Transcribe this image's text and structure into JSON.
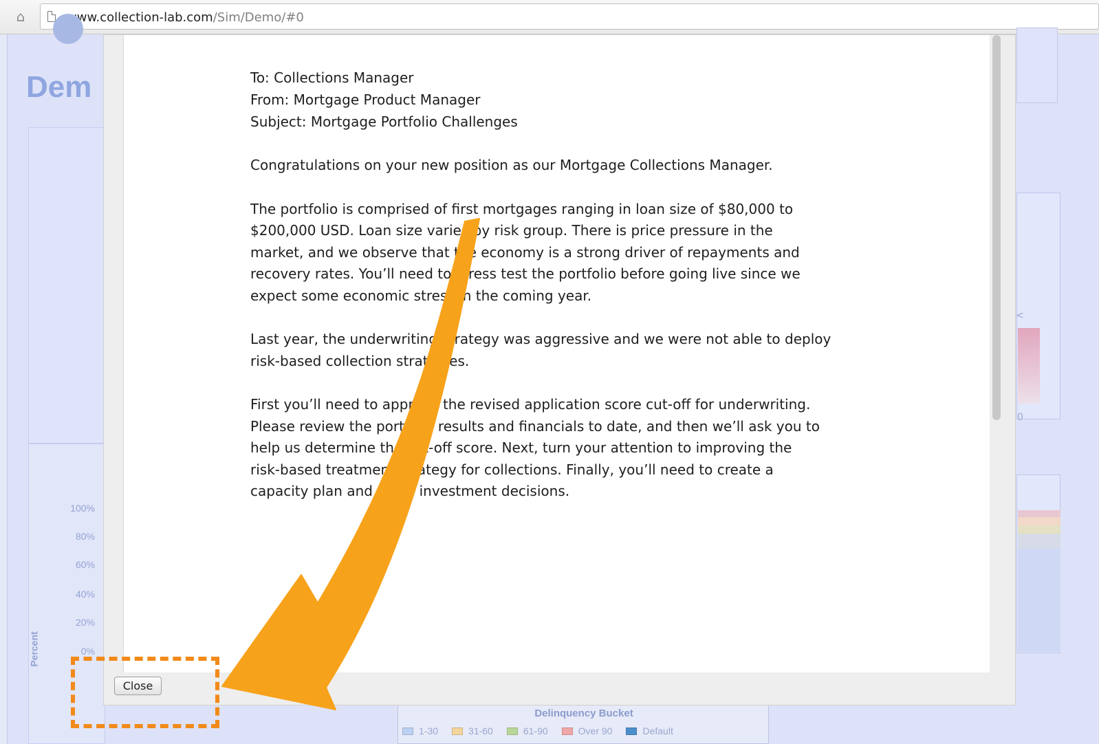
{
  "browser": {
    "url_domain": "www.collection-lab.com",
    "url_path": "/Sim/Demo/#0",
    "icons": {
      "home": "home-icon",
      "page": "page-icon"
    }
  },
  "background_app": {
    "title_fragment": "Dem",
    "chart": {
      "y_ticks": [
        "100%",
        "80%",
        "60%",
        "40%",
        "20%",
        "0%"
      ],
      "y_label": "Percent",
      "legend_title": "Delinquency Bucket",
      "legend": [
        {
          "label": "1-30",
          "color": "#bcd2f4"
        },
        {
          "label": "31-60",
          "color": "#f3d49b"
        },
        {
          "label": "61-90",
          "color": "#b9d898"
        },
        {
          "label": "Over 90",
          "color": "#f0a7a7"
        },
        {
          "label": "Default",
          "color": "#4a8fc9"
        }
      ]
    },
    "right_edge_fragments": [
      "<",
      "0"
    ]
  },
  "modal": {
    "header": {
      "to": "To:  Collections Manager",
      "from": "From:  Mortgage Product Manager",
      "subject": "Subject:  Mortgage Portfolio Challenges"
    },
    "paragraphs": [
      [
        "Congratulations on your new position as our Mortgage Collections Manager."
      ],
      [
        "The portfolio is comprised of first mortgages ranging in loan size of $80,000 to",
        "$200,000 USD.    Loan size varies by risk group.  There is price pressure in the",
        "market, and we observe that the economy is a strong driver of repayments and",
        "recovery rates.  You’ll need to stress test the portfolio before going live since we",
        "expect some economic stress in the coming year."
      ],
      [
        "Last year, the underwriting strategy was aggressive and we were not able to deploy",
        "risk-based collection strategies."
      ],
      [
        "First you’ll need to approve the revised application score cut-off for underwriting.",
        "Please review the portfolio results and financials to date, and then we’ll ask you to",
        "help us determine the cut-off score.   Next, turn your attention to improving the",
        "risk-based treatment strategy for collections.    Finally, you’ll need to create a",
        "capacity plan and make investment decisions."
      ]
    ],
    "close_label": "Close"
  },
  "annotation": {
    "arrow_color": "#f7a21b",
    "box_color": "#f28a1a"
  }
}
